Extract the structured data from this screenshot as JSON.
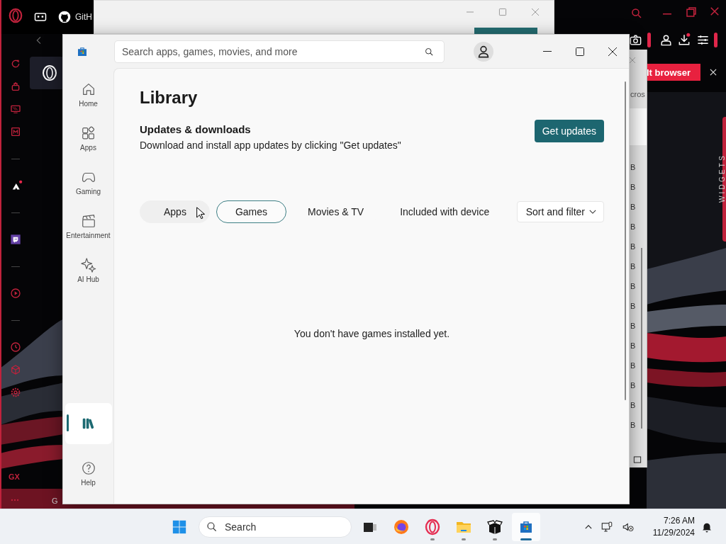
{
  "browser": {
    "tab_title": "GitH",
    "banner_button": "lt browser",
    "widgets_label": "WIDGETS",
    "sidebar_badge": "GX",
    "status_text": "G"
  },
  "side_window": {
    "heading": "cros",
    "sizes": [
      "B",
      "B",
      "B",
      "B",
      "B",
      "B",
      "B",
      "B",
      "B",
      "B",
      "B",
      "B",
      "B",
      "B"
    ]
  },
  "store": {
    "search": {
      "placeholder": "Search apps, games, movies, and more"
    },
    "nav": [
      {
        "kind": "home",
        "label": "Home",
        "selected": false
      },
      {
        "kind": "apps",
        "label": "Apps",
        "selected": false
      },
      {
        "kind": "gaming",
        "label": "Gaming",
        "selected": false
      },
      {
        "kind": "entertainment",
        "label": "Entertainment",
        "selected": false
      },
      {
        "kind": "ai-hub",
        "label": "AI Hub",
        "selected": false
      },
      {
        "kind": "library",
        "selected": true
      },
      {
        "kind": "help",
        "label": "Help",
        "selected": false
      }
    ],
    "title": "Library",
    "updates": {
      "heading": "Updates & downloads",
      "description": "Download and install app updates by clicking \"Get updates\"",
      "button": "Get updates"
    },
    "filters": [
      {
        "label": "Apps",
        "selected": false,
        "hovered": true
      },
      {
        "label": "Games",
        "selected": true,
        "hovered": false
      },
      {
        "label": "Movies & TV",
        "selected": false,
        "hovered": false
      },
      {
        "label": "Included with device",
        "selected": false,
        "hovered": false
      }
    ],
    "sort_button": "Sort and filter",
    "empty_message": "You don't have games installed yet."
  },
  "taskbar": {
    "search": {
      "placeholder": "Search"
    },
    "apps": [
      {
        "kind": "task-view",
        "running": false,
        "selected": false
      },
      {
        "kind": "firefox",
        "running": false,
        "selected": false
      },
      {
        "kind": "opera",
        "running": true,
        "selected": false
      },
      {
        "kind": "explorer",
        "running": true,
        "selected": false
      },
      {
        "kind": "box",
        "running": true,
        "selected": false
      },
      {
        "kind": "store",
        "running": true,
        "selected": true
      }
    ],
    "time": "7:26 AM",
    "date": "11/29/2024"
  }
}
